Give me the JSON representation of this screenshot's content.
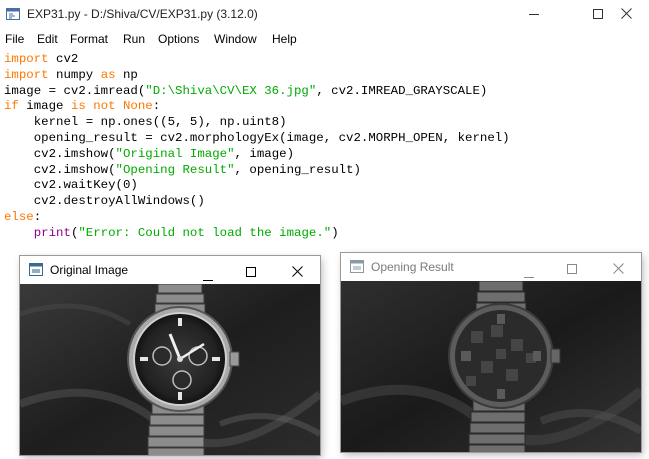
{
  "window": {
    "title": "EXP31.py - D:/Shiva/CV/EXP31.py (3.12.0)",
    "icon": "idle-python-icon",
    "controls": [
      "minimize-icon",
      "maximize-icon",
      "close-icon"
    ]
  },
  "menu": {
    "items": [
      "File",
      "Edit",
      "Format",
      "Run",
      "Options",
      "Window",
      "Help"
    ]
  },
  "colors": {
    "keyword": "#ff7700",
    "builtin": "#900090",
    "string": "#00aa00",
    "text": "#000000"
  },
  "code": {
    "kw_import": "import",
    "kw_as": "as",
    "kw_if": "if",
    "kw_is": "is",
    "kw_not": "not",
    "kw_none": "None",
    "kw_else": "else",
    "builtin_print": "print",
    "line1_rest": " cv2",
    "line2_mid": " numpy ",
    "line2_rest": " np",
    "line3_a": "image = cv2.imread(",
    "line3_str": "\"D:\\Shiva\\CV\\EX 36.jpg\"",
    "line3_b": ", cv2.IMREAD_GRAYSCALE)",
    "line5": "    kernel = np.ones((5, 5), np.uint8)",
    "line6": "    opening_result = cv2.morphologyEx(image, cv2.MORPH_OPEN, kernel)",
    "line7_a": "    cv2.imshow(",
    "line7_str": "\"Original Image\"",
    "line7_b": ", image)",
    "line8_a": "    cv2.imshow(",
    "line8_str": "\"Opening Result\"",
    "line8_b": ", opening_result)",
    "line9": "    cv2.waitKey(0)",
    "line10": "    cv2.destroyAllWindows()",
    "line12_str": "\"Error: Could not load the image.\""
  },
  "original_window": {
    "title": "Original Image",
    "icon": "opencv-window-icon",
    "active": true
  },
  "opening_window": {
    "title": "Opening Result",
    "icon": "opencv-window-icon",
    "active": false
  }
}
